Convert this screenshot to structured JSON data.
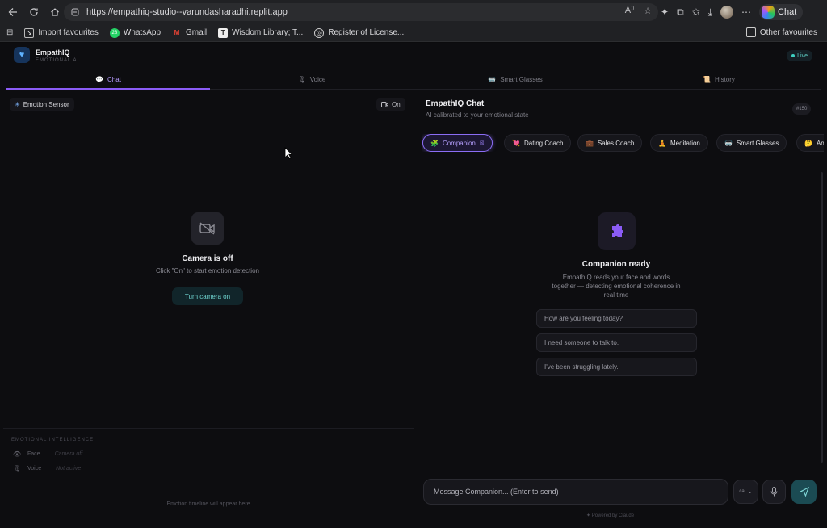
{
  "browser": {
    "url": "https://empathiq-studio--varundasharadhi.replit.app",
    "chat_label": "Chat",
    "bookmarks": [
      {
        "label": "Import favourites"
      },
      {
        "label": "WhatsApp",
        "badge": "28"
      },
      {
        "label": "Gmail"
      },
      {
        "label": "Wisdom Library; T..."
      },
      {
        "label": "Register of License..."
      }
    ],
    "other_favourites": "Other favourites"
  },
  "app": {
    "title": "EmpathIQ",
    "subtitle": "EMOTIONAL AI",
    "live_label": "Live",
    "tabs": [
      {
        "label": "Chat",
        "icon": "speech-bubble-icon",
        "active": true
      },
      {
        "label": "Voice",
        "icon": "microphone-icon",
        "active": false
      },
      {
        "label": "Smart Glasses",
        "icon": "glasses-icon",
        "active": false
      },
      {
        "label": "History",
        "icon": "scroll-icon",
        "active": false
      }
    ]
  },
  "left_pane": {
    "sensor_label": "Emotion Sensor",
    "camera_toggle": "On",
    "camera_title": "Camera is off",
    "camera_hint": "Click \"On\" to start emotion detection",
    "camera_button": "Turn camera on",
    "ei_title": "EMOTIONAL INTELLIGENCE",
    "ei_rows": [
      {
        "label": "Face",
        "value": "Camera off",
        "icon": "eye-icon"
      },
      {
        "label": "Voice",
        "value": "Not active",
        "icon": "microphone-icon"
      }
    ],
    "timeline_placeholder": "Emotion timeline will appear here"
  },
  "right_pane": {
    "title": "EmpathIQ Chat",
    "subtitle": "AI calibrated to your emotional state",
    "badge": "#150",
    "modes": [
      {
        "label": "Companion",
        "icon": "puzzle-icon",
        "active": true
      },
      {
        "label": "Dating Coach",
        "icon": "heart-icon",
        "active": false
      },
      {
        "label": "Sales Coach",
        "icon": "briefcase-icon",
        "active": false
      },
      {
        "label": "Meditation",
        "icon": "meditation-icon",
        "active": false
      },
      {
        "label": "Smart Glasses",
        "icon": "glasses-icon",
        "active": false
      },
      {
        "label": "An",
        "icon": "face-icon",
        "active": false
      }
    ],
    "ready_title": "Companion ready",
    "ready_desc": "EmpathIQ reads your face and words together — detecting emotional coherence in real time",
    "suggestions": [
      "How are you feeling today?",
      "I need someone to talk to.",
      "I've been struggling lately."
    ],
    "input_placeholder": "Message Companion... (Enter to send)",
    "language": "ca",
    "powered_by": "Powered by Claude"
  },
  "colors": {
    "accent": "#8b5cf6",
    "teal": "#3ed1c2",
    "background": "#0d0d10"
  }
}
